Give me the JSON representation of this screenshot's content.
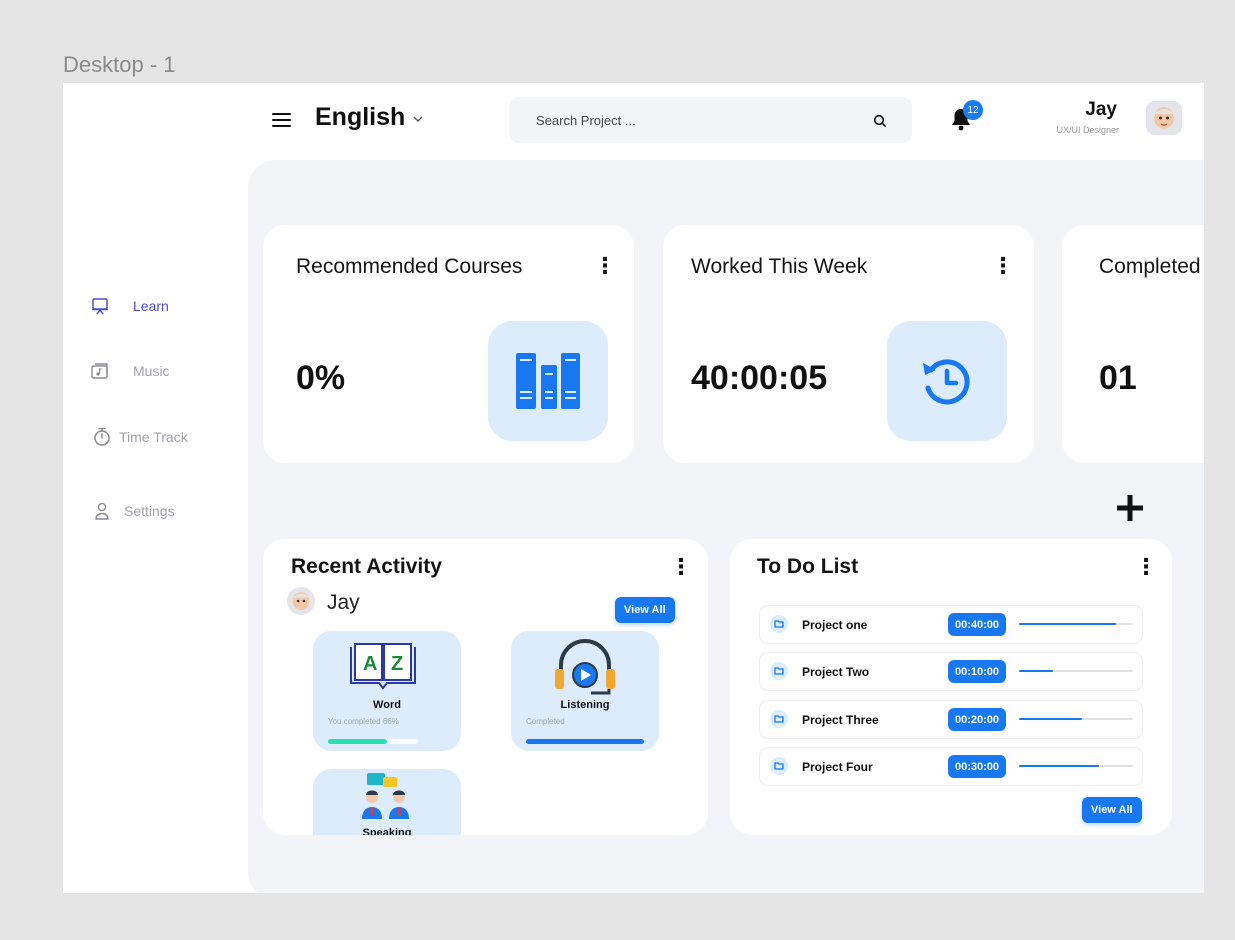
{
  "frame_label": "Desktop - 1",
  "header": {
    "language": "English",
    "search_placeholder": "Search Project ...",
    "notification_count": "12",
    "user_name": "Jay",
    "user_role": "UX/UI Designer"
  },
  "sidebar": {
    "items": [
      {
        "label": "Learn",
        "icon": "monitor-icon",
        "active": true
      },
      {
        "label": "Music",
        "icon": "music-icon",
        "active": false
      },
      {
        "label": "Time Track",
        "icon": "stopwatch-icon",
        "active": false
      },
      {
        "label": "Settings",
        "icon": "user-icon",
        "active": false
      }
    ]
  },
  "stats": [
    {
      "title": "Recommended Courses",
      "value": "0%",
      "icon": "books-icon"
    },
    {
      "title": "Worked This Week",
      "value": "40:00:05",
      "icon": "history-clock-icon"
    },
    {
      "title": "Completed",
      "value": "01",
      "icon": ""
    }
  ],
  "recent_activity": {
    "title": "Recent Activity",
    "user": "Jay",
    "view_all": "View All",
    "tiles": [
      {
        "title": "Word",
        "subtitle": "You completed 66%",
        "progress": 0.66,
        "color": "#27e0b3",
        "icon": "dictionary-icon"
      },
      {
        "title": "Listening",
        "subtitle": "Completed",
        "progress": 1.0,
        "color": "#1778f2",
        "icon": "headphones-icon"
      },
      {
        "title": "Speaking",
        "subtitle": "",
        "progress": 0,
        "color": "#1778f2",
        "icon": "conversation-icon"
      }
    ]
  },
  "todo": {
    "title": "To Do List",
    "view_all": "View All",
    "items": [
      {
        "name": "Project one",
        "time": "00:40:00",
        "progress": 0.85
      },
      {
        "name": "Project Two",
        "time": "00:10:00",
        "progress": 0.3
      },
      {
        "name": "Project Three",
        "time": "00:20:00",
        "progress": 0.55
      },
      {
        "name": "Project Four",
        "time": "00:30:00",
        "progress": 0.7
      }
    ]
  },
  "colors": {
    "accent": "#1778f2",
    "active_nav": "#4b4bd6",
    "icon_box": "#dcecfc",
    "word_progress": "#27e0b3"
  }
}
